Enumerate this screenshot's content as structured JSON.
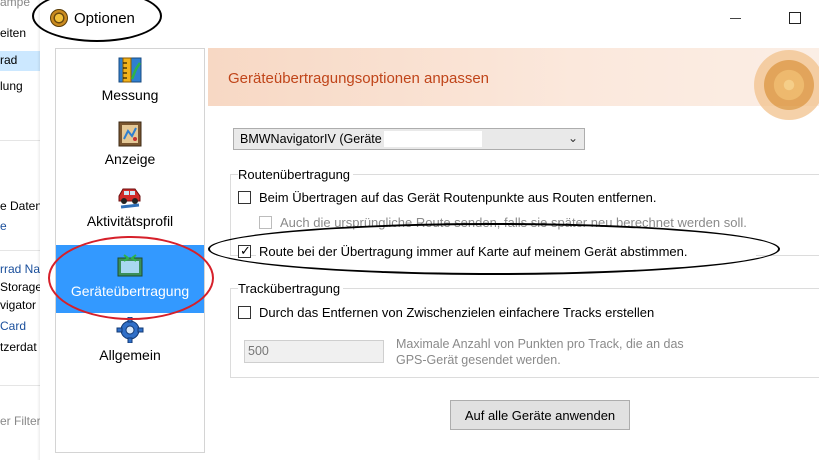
{
  "background_app": {
    "items": [
      "ampe",
      "eiten",
      "rad",
      "lung",
      "e Daten",
      "e",
      "rrad Na",
      "Storage",
      "vigator E",
      "Card",
      "tzerdat",
      "er Filter"
    ]
  },
  "window": {
    "title": "Optionen"
  },
  "nav": {
    "items": [
      {
        "label": "Messung"
      },
      {
        "label": "Anzeige"
      },
      {
        "label": "Aktivitätsprofil"
      },
      {
        "label": "Geräteübertragung",
        "active": true
      },
      {
        "label": "Allgemein"
      }
    ]
  },
  "content": {
    "header_title": "Geräteübertragungsoptionen anpassen",
    "device_select": {
      "value": "BMWNavigatorIV (Geräte"
    },
    "route_group": {
      "label": "Routenübertragung",
      "options": [
        {
          "label": "Beim Übertragen auf das Gerät Routenpunkte aus Routen entfernen.",
          "checked": false,
          "enabled": true
        },
        {
          "label": "Auch die ursprüngliche Route senden, falls sie später neu berechnet werden soll.",
          "checked": false,
          "enabled": false
        },
        {
          "label": "Route bei der Übertragung immer auf Karte auf meinem Gerät abstimmen.",
          "checked": true,
          "enabled": true
        }
      ]
    },
    "track_group": {
      "label": "Trackübertragung",
      "option": {
        "label": "Durch das Entfernen von Zwischenzielen einfachere Tracks erstellen",
        "checked": false
      },
      "max_points_value": "500",
      "max_points_hint": "Maximale Anzahl von Punkten pro Track, die an das GPS-Gerät gesendet werden."
    },
    "apply_button": "Auf alle Geräte anwenden"
  }
}
